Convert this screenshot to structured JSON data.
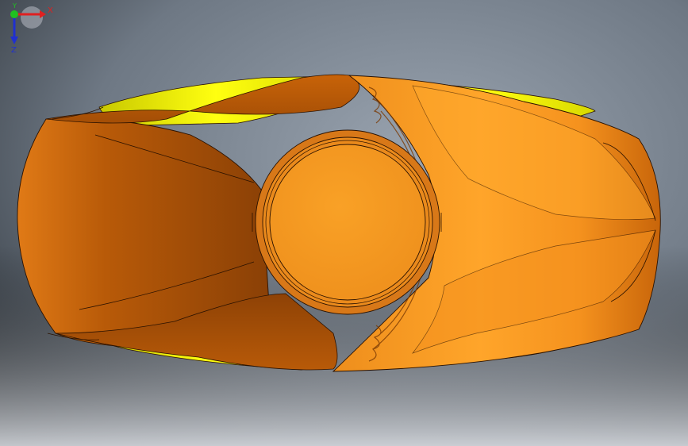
{
  "viewport": {
    "background_top": "#8e99a6",
    "background_dark_left": "#1f2429",
    "background_bottom": "#d3d6dc"
  },
  "model": {
    "body_color": "#e8821a",
    "body_dark": "#8a3e05",
    "face_color": "#f59a22",
    "highlight_color": "#ffb033",
    "pocket_color": "#e6e600",
    "pocket_shadow": "#a0a000",
    "edge_color": "#2b1200"
  },
  "triad": {
    "x_label": "X",
    "y_label": "Y",
    "z_label": "Z",
    "x_color": "#e02020",
    "y_color": "#20c020",
    "z_color": "#2030d0"
  }
}
